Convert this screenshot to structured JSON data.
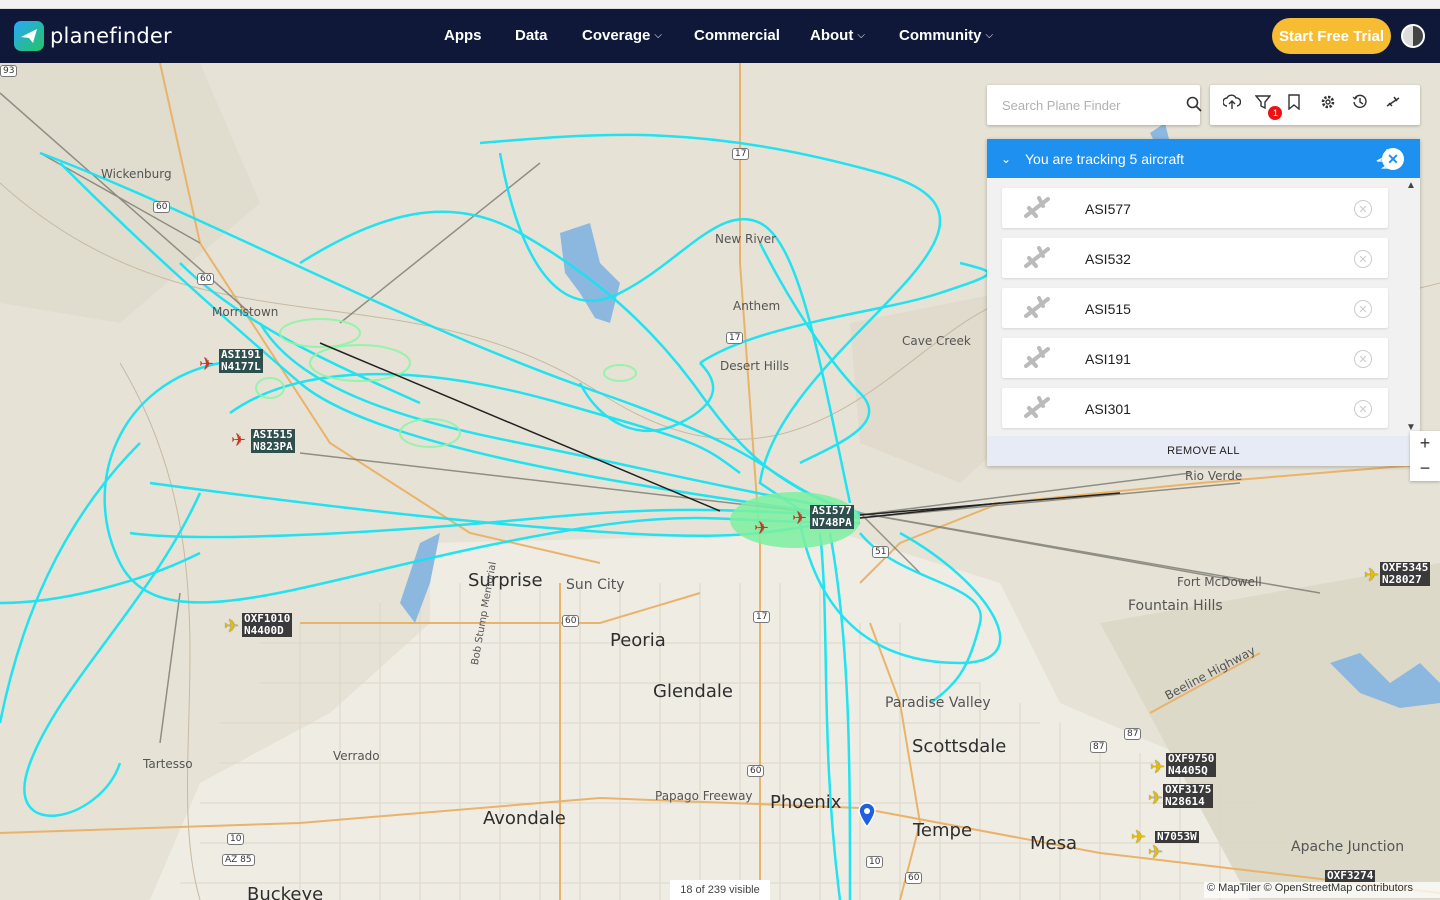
{
  "brand": {
    "name": "planefinder"
  },
  "nav": {
    "apps": "Apps",
    "data": "Data",
    "coverage": "Coverage",
    "commercial": "Commercial",
    "about": "About",
    "community": "Community",
    "trial": "Start Free Trial"
  },
  "search": {
    "placeholder": "Search Plane Finder"
  },
  "filter_badge": "1",
  "tracking": {
    "title": "You are tracking 5 aircraft",
    "items": [
      {
        "label": "ASI577"
      },
      {
        "label": "ASI532"
      },
      {
        "label": "ASI515"
      },
      {
        "label": "ASI191"
      },
      {
        "label": "ASI301"
      }
    ],
    "remove_all": "REMOVE ALL"
  },
  "zoom": {
    "in": "+",
    "out": "−"
  },
  "status": {
    "visible": "18 of 239 visible"
  },
  "attribution": "© MapTiler © OpenStreetMap contributors",
  "places": {
    "wickenburg": "Wickenburg",
    "morristown": "Morristown",
    "new_river": "New River",
    "anthem": "Anthem",
    "cave_creek": "Cave Creek",
    "desert_hills": "Desert Hills",
    "rio_verde": "Rio Verde",
    "surprise": "Surprise",
    "sun_city": "Sun City",
    "peoria": "Peoria",
    "glendale": "Glendale",
    "fort_mcdowell": "Fort McDowell",
    "fountain_hills": "Fountain Hills",
    "beeline": "Beeline Highway",
    "paradise_valley": "Paradise Valley",
    "scottsdale": "Scottsdale",
    "tartesso": "Tartesso",
    "verrado": "Verrado",
    "papago": "Papago Freeway",
    "phoenix": "Phoenix",
    "avondale": "Avondale",
    "tempe": "Tempe",
    "mesa": "Mesa",
    "apache_junction": "Apache Junction",
    "buckeye": "Buckeye",
    "bob_stump": "Bob Stump Memorial"
  },
  "shields": [
    "93",
    "60",
    "60",
    "17",
    "17",
    "17",
    "51",
    "60",
    "60",
    "10",
    "10",
    "87",
    "87",
    "AZ 85",
    "60"
  ],
  "aircraft_tags": {
    "asi191": {
      "line1": "ASI191",
      "line2": "N4177L"
    },
    "asi515": {
      "line1": "ASI515",
      "line2": "N823PA"
    },
    "asi577": {
      "line1": "ASI577",
      "line2": "N748PA"
    },
    "oxf1010": {
      "line1": "OXF1010",
      "line2": "N4400D"
    },
    "oxf5345": {
      "line1": "OXF5345",
      "line2": "N28027"
    },
    "oxf9750": {
      "line1": "OXF9750",
      "line2": "N4405Q"
    },
    "oxf3175": {
      "line1": "OXF3175",
      "line2": "N28614"
    },
    "n7053w": {
      "line1": "N7053W"
    },
    "oxf3274": {
      "line1": "OXF3274"
    }
  },
  "colors": {
    "navbar": "#0f1838",
    "trial": "#f6bd33",
    "tracks": "#17e3f2",
    "panel_header": "#1e90f0",
    "map_land": "#e6e2d6"
  }
}
